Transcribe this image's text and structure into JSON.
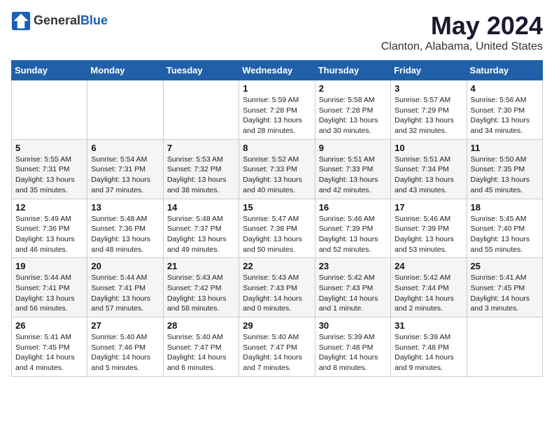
{
  "logo": {
    "general": "General",
    "blue": "Blue"
  },
  "title": "May 2024",
  "subtitle": "Clanton, Alabama, United States",
  "headers": [
    "Sunday",
    "Monday",
    "Tuesday",
    "Wednesday",
    "Thursday",
    "Friday",
    "Saturday"
  ],
  "weeks": [
    [
      {
        "day": "",
        "info": ""
      },
      {
        "day": "",
        "info": ""
      },
      {
        "day": "",
        "info": ""
      },
      {
        "day": "1",
        "info": "Sunrise: 5:59 AM\nSunset: 7:28 PM\nDaylight: 13 hours\nand 28 minutes."
      },
      {
        "day": "2",
        "info": "Sunrise: 5:58 AM\nSunset: 7:28 PM\nDaylight: 13 hours\nand 30 minutes."
      },
      {
        "day": "3",
        "info": "Sunrise: 5:57 AM\nSunset: 7:29 PM\nDaylight: 13 hours\nand 32 minutes."
      },
      {
        "day": "4",
        "info": "Sunrise: 5:56 AM\nSunset: 7:30 PM\nDaylight: 13 hours\nand 34 minutes."
      }
    ],
    [
      {
        "day": "5",
        "info": "Sunrise: 5:55 AM\nSunset: 7:31 PM\nDaylight: 13 hours\nand 35 minutes."
      },
      {
        "day": "6",
        "info": "Sunrise: 5:54 AM\nSunset: 7:31 PM\nDaylight: 13 hours\nand 37 minutes."
      },
      {
        "day": "7",
        "info": "Sunrise: 5:53 AM\nSunset: 7:32 PM\nDaylight: 13 hours\nand 38 minutes."
      },
      {
        "day": "8",
        "info": "Sunrise: 5:52 AM\nSunset: 7:33 PM\nDaylight: 13 hours\nand 40 minutes."
      },
      {
        "day": "9",
        "info": "Sunrise: 5:51 AM\nSunset: 7:33 PM\nDaylight: 13 hours\nand 42 minutes."
      },
      {
        "day": "10",
        "info": "Sunrise: 5:51 AM\nSunset: 7:34 PM\nDaylight: 13 hours\nand 43 minutes."
      },
      {
        "day": "11",
        "info": "Sunrise: 5:50 AM\nSunset: 7:35 PM\nDaylight: 13 hours\nand 45 minutes."
      }
    ],
    [
      {
        "day": "12",
        "info": "Sunrise: 5:49 AM\nSunset: 7:36 PM\nDaylight: 13 hours\nand 46 minutes."
      },
      {
        "day": "13",
        "info": "Sunrise: 5:48 AM\nSunset: 7:36 PM\nDaylight: 13 hours\nand 48 minutes."
      },
      {
        "day": "14",
        "info": "Sunrise: 5:48 AM\nSunset: 7:37 PM\nDaylight: 13 hours\nand 49 minutes."
      },
      {
        "day": "15",
        "info": "Sunrise: 5:47 AM\nSunset: 7:38 PM\nDaylight: 13 hours\nand 50 minutes."
      },
      {
        "day": "16",
        "info": "Sunrise: 5:46 AM\nSunset: 7:39 PM\nDaylight: 13 hours\nand 52 minutes."
      },
      {
        "day": "17",
        "info": "Sunrise: 5:46 AM\nSunset: 7:39 PM\nDaylight: 13 hours\nand 53 minutes."
      },
      {
        "day": "18",
        "info": "Sunrise: 5:45 AM\nSunset: 7:40 PM\nDaylight: 13 hours\nand 55 minutes."
      }
    ],
    [
      {
        "day": "19",
        "info": "Sunrise: 5:44 AM\nSunset: 7:41 PM\nDaylight: 13 hours\nand 56 minutes."
      },
      {
        "day": "20",
        "info": "Sunrise: 5:44 AM\nSunset: 7:41 PM\nDaylight: 13 hours\nand 57 minutes."
      },
      {
        "day": "21",
        "info": "Sunrise: 5:43 AM\nSunset: 7:42 PM\nDaylight: 13 hours\nand 58 minutes."
      },
      {
        "day": "22",
        "info": "Sunrise: 5:43 AM\nSunset: 7:43 PM\nDaylight: 14 hours\nand 0 minutes."
      },
      {
        "day": "23",
        "info": "Sunrise: 5:42 AM\nSunset: 7:43 PM\nDaylight: 14 hours\nand 1 minute."
      },
      {
        "day": "24",
        "info": "Sunrise: 5:42 AM\nSunset: 7:44 PM\nDaylight: 14 hours\nand 2 minutes."
      },
      {
        "day": "25",
        "info": "Sunrise: 5:41 AM\nSunset: 7:45 PM\nDaylight: 14 hours\nand 3 minutes."
      }
    ],
    [
      {
        "day": "26",
        "info": "Sunrise: 5:41 AM\nSunset: 7:45 PM\nDaylight: 14 hours\nand 4 minutes."
      },
      {
        "day": "27",
        "info": "Sunrise: 5:40 AM\nSunset: 7:46 PM\nDaylight: 14 hours\nand 5 minutes."
      },
      {
        "day": "28",
        "info": "Sunrise: 5:40 AM\nSunset: 7:47 PM\nDaylight: 14 hours\nand 6 minutes."
      },
      {
        "day": "29",
        "info": "Sunrise: 5:40 AM\nSunset: 7:47 PM\nDaylight: 14 hours\nand 7 minutes."
      },
      {
        "day": "30",
        "info": "Sunrise: 5:39 AM\nSunset: 7:48 PM\nDaylight: 14 hours\nand 8 minutes."
      },
      {
        "day": "31",
        "info": "Sunrise: 5:39 AM\nSunset: 7:48 PM\nDaylight: 14 hours\nand 9 minutes."
      },
      {
        "day": "",
        "info": ""
      }
    ]
  ]
}
